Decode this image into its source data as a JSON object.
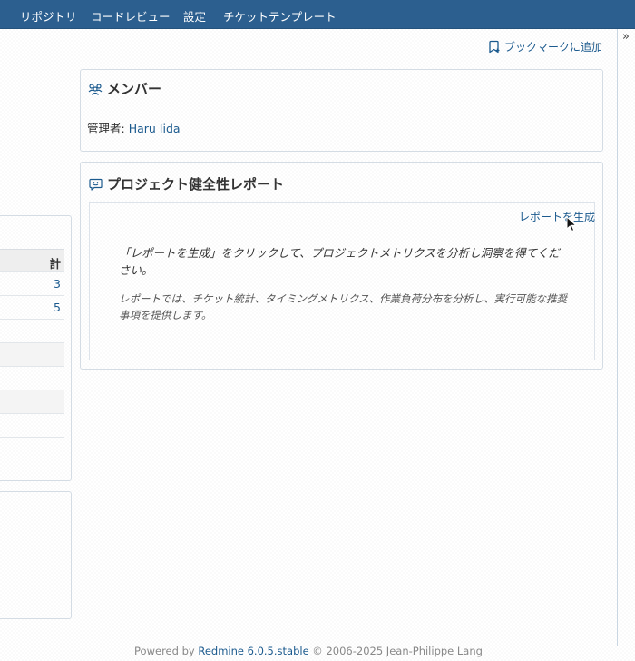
{
  "top_menu": {
    "tabs": [
      "リポジトリ",
      "コードレビュー",
      "設定",
      "チケットテンプレート"
    ]
  },
  "sidebar_toggle": {
    "label": "»"
  },
  "contextual": {
    "bookmark_label": "ブックマークに追加",
    "bookmark_icon": "bookmark-icon",
    "more_label": "⋯"
  },
  "members_box": {
    "title": "メンバー",
    "icon": "people-icon",
    "manager_label": "管理者: ",
    "manager_name": "Haru Iida"
  },
  "health_box": {
    "title": "プロジェクト健全性レポート",
    "icon": "chat-icon",
    "generate_link": "レポートを生成",
    "description": "「レポートを生成」をクリックして、プロジェクトメトリクスを分析し洞察を得てください。",
    "sub_description": "レポートでは、チケット統計、タイミングメトリクス、作業負荷分布を分析し、実行可能な推奨事項を提供します。"
  },
  "left_table": {
    "header": "計",
    "rows": [
      "3",
      "5",
      "",
      "",
      "",
      "",
      ""
    ]
  },
  "footer": {
    "prefix": "Powered by ",
    "app_link": "Redmine 6.0.5.stable",
    "suffix": " © 2006-2025 Jean-Philippe Lang"
  },
  "colors": {
    "nav_bg": "#2c5f8f",
    "link": "#1b5a8e",
    "border": "#d4dce4"
  }
}
